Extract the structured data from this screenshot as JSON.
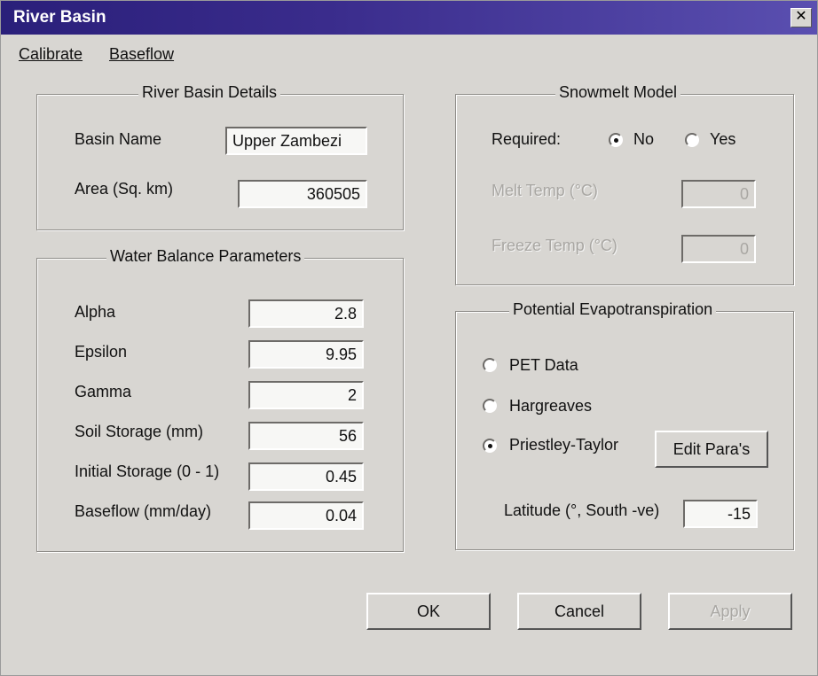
{
  "window": {
    "title": "River Basin",
    "close_glyph": "✕"
  },
  "menu": {
    "calibrate": "Calibrate",
    "baseflow": "Baseflow"
  },
  "river_basin_details": {
    "title": "River Basin Details",
    "basin_name_label": "Basin Name",
    "basin_name_value": "Upper Zambezi",
    "area_label": "Area (Sq. km)",
    "area_value": "360505"
  },
  "water_balance": {
    "title": "Water Balance Parameters",
    "rows": [
      {
        "label": "Alpha",
        "value": "2.8"
      },
      {
        "label": "Epsilon",
        "value": "9.95"
      },
      {
        "label": "Gamma",
        "value": "2"
      },
      {
        "label": "Soil Storage (mm)",
        "value": "56"
      },
      {
        "label": "Initial Storage (0 - 1)",
        "value": "0.45"
      },
      {
        "label": "Baseflow (mm/day)",
        "value": "0.04"
      }
    ]
  },
  "snowmelt": {
    "title": "Snowmelt Model",
    "required_label": "Required:",
    "no_label": "No",
    "yes_label": "Yes",
    "selected": "No",
    "melt_temp_label": "Melt Temp (°C)",
    "melt_temp_value": "0",
    "freeze_temp_label": "Freeze Temp (°C)",
    "freeze_temp_value": "0"
  },
  "pet": {
    "title": "Potential Evapotranspiration",
    "options": [
      "PET Data",
      "Hargreaves",
      "Priestley-Taylor"
    ],
    "selected": "Priestley-Taylor",
    "edit_button": "Edit Para's",
    "latitude_label": "Latitude (°, South -ve)",
    "latitude_value": "-15"
  },
  "buttons": {
    "ok": "OK",
    "cancel": "Cancel",
    "apply": "Apply"
  }
}
